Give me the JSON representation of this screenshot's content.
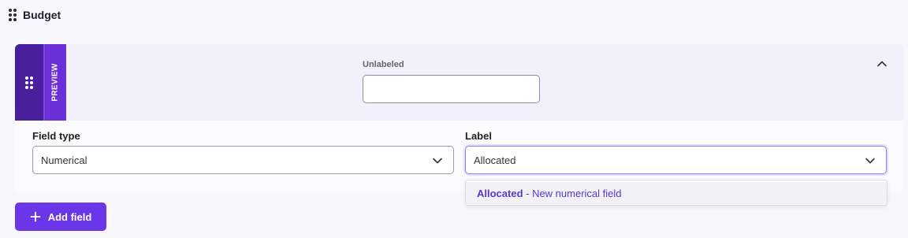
{
  "section": {
    "title": "Budget"
  },
  "preview": {
    "tab_label": "PREVIEW",
    "field_label": "Unlabeled",
    "field_value": ""
  },
  "config": {
    "field_type": {
      "label": "Field type",
      "value": "Numerical"
    },
    "label_field": {
      "label": "Label",
      "value": "Allocated"
    }
  },
  "dropdown": {
    "options": [
      {
        "name": "Allocated",
        "suffix": " - New numerical field"
      }
    ]
  },
  "add_field": {
    "label": "Add field"
  },
  "colors": {
    "accent": "#6b36e8",
    "handle": "#4a1f9e",
    "preview_tab": "#6a2fd6",
    "preview_bg": "#f3f0fe",
    "option_text": "#5b35d5"
  }
}
